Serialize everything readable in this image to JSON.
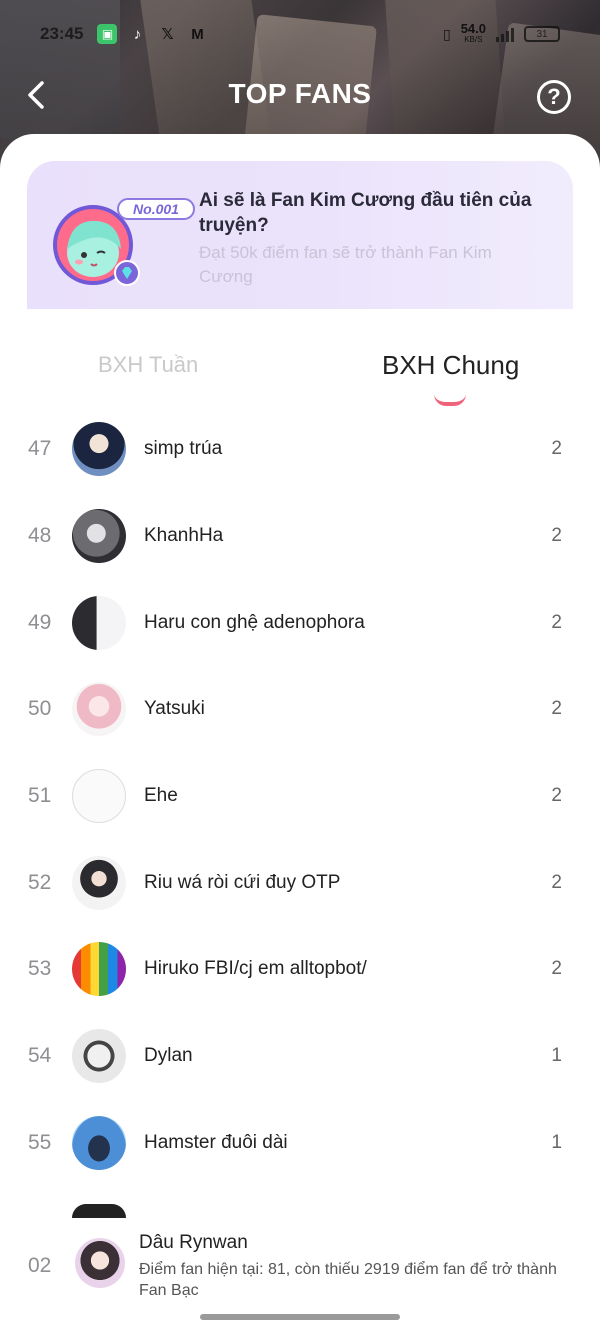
{
  "status_bar": {
    "time": "23:45",
    "net_speed": "54.0",
    "net_unit": "KB/S",
    "battery": "31"
  },
  "header": {
    "title": "TOP FANS",
    "help_label": "?"
  },
  "banner": {
    "badge": "No.001",
    "title": "Ai sẽ là Fan Kim Cương đầu tiên của truyện?",
    "subtitle": "Đạt 50k điểm fan sẽ trở thành Fan Kim Cương"
  },
  "tabs": {
    "weekly": "BXH Tuần",
    "overall": "BXH Chung"
  },
  "rankings": [
    {
      "rank": "47",
      "name": "simp trúa",
      "score": "2"
    },
    {
      "rank": "48",
      "name": "KhanhHa",
      "score": "2"
    },
    {
      "rank": "49",
      "name": "Haru con ghệ adenophora",
      "score": "2"
    },
    {
      "rank": "50",
      "name": "Yatsuki",
      "score": "2"
    },
    {
      "rank": "51",
      "name": "Ehe",
      "score": "2"
    },
    {
      "rank": "52",
      "name": "Riu wá ròi cứi đuy OTP",
      "score": "2"
    },
    {
      "rank": "53",
      "name": "Hiruko FBI/cj em alltopbot/",
      "score": "2"
    },
    {
      "rank": "54",
      "name": "Dylan",
      "score": "1"
    },
    {
      "rank": "55",
      "name": "Hamster đuôi dài",
      "score": "1"
    }
  ],
  "my_rank": {
    "rank": "02",
    "name": "Dâu Rynwan",
    "info": "Điểm fan hiện tại: 81, còn thiếu 2919 điểm fan để trở thành Fan Bạc"
  },
  "colors": {
    "accent": "#f0647b",
    "banner_purple": "#7b66d9"
  }
}
